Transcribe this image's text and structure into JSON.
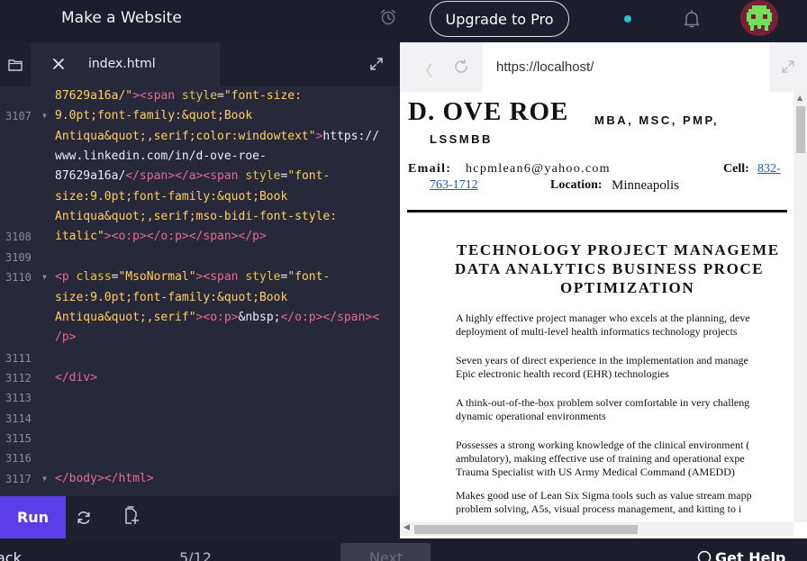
{
  "header": {
    "app_title": "Make a Website",
    "upgrade_label": "Upgrade to Pro"
  },
  "editor": {
    "tab_filename": "index.html",
    "lines": [
      {
        "num": "",
        "fold": false,
        "html": "<span class='s'>87629a16a/\"</span><span class='t'>&gt;&lt;span </span><span class='a'>style</span><span class='w'>=</span><span class='s'>\"font-size:</span>"
      },
      {
        "num": "3107",
        "fold": true,
        "html": "<span class='s'>9.0pt;font-family:&amp;quot;Book</span>"
      },
      {
        "num": "",
        "fold": false,
        "html": "<span class='s'>Antiqua&amp;quot;,serif;color:windowtext\"</span><span class='t'>&gt;</span><span class='w'>https://</span>"
      },
      {
        "num": "",
        "fold": false,
        "html": "<span class='w'>www.linkedin.com/in/d-ove-roe-</span>"
      },
      {
        "num": "",
        "fold": false,
        "html": "<span class='w'>87629a16a/</span><span class='t'>&lt;/span&gt;&lt;/a&gt;&lt;span </span><span class='a'>style</span><span class='w'>=</span><span class='s'>\"font-</span>"
      },
      {
        "num": "",
        "fold": false,
        "html": "<span class='s'>size:9.0pt;font-family:&amp;quot;Book</span>"
      },
      {
        "num": "",
        "fold": false,
        "html": "<span class='s'>Antiqua&amp;quot;,serif;mso-bidi-font-style:</span>"
      },
      {
        "num": "3108",
        "fold": false,
        "html": "<span class='s'>italic\"</span><span class='t'>&gt;&lt;o:p&gt;&lt;/o:p&gt;&lt;/span&gt;&lt;/p&gt;</span>"
      },
      {
        "num": "3109",
        "fold": false,
        "html": ""
      },
      {
        "num": "3110",
        "fold": true,
        "html": "<span class='t'>&lt;p </span><span class='a'>class</span><span class='w'>=</span><span class='s'>\"MsoNormal\"</span><span class='t'>&gt;&lt;span </span><span class='a'>style</span><span class='w'>=</span><span class='s'>\"font-</span>"
      },
      {
        "num": "",
        "fold": false,
        "html": "<span class='s'>size:9.0pt;font-family:&amp;quot;Book</span>"
      },
      {
        "num": "",
        "fold": false,
        "html": "<span class='s'>Antiqua&amp;quot;,serif\"</span><span class='t'>&gt;&lt;o:p&gt;</span><span class='w'>&amp;nbsp;</span><span class='t'>&lt;/o:p&gt;&lt;/span&gt;&lt;</span>"
      },
      {
        "num": "",
        "fold": false,
        "html": "<span class='t'>/p&gt;</span>"
      },
      {
        "num": "3111",
        "fold": false,
        "html": ""
      },
      {
        "num": "3112",
        "fold": false,
        "html": "<span class='t'>&lt;/div&gt;</span>"
      },
      {
        "num": "3113",
        "fold": false,
        "html": ""
      },
      {
        "num": "3114",
        "fold": false,
        "html": ""
      },
      {
        "num": "3115",
        "fold": false,
        "html": ""
      },
      {
        "num": "3116",
        "fold": false,
        "html": ""
      },
      {
        "num": "3117",
        "fold": true,
        "html": "<span class='t'>&lt;/body&gt;&lt;/html&gt;</span>"
      }
    ]
  },
  "runbar": {
    "run_label": "Run"
  },
  "browser": {
    "url": "https://localhost/",
    "document": {
      "name": "D. OVE ROE",
      "credentials_line1": "MBA, MSC, PMP,",
      "credentials_line2": "LSSMBB",
      "email_label": "Email:",
      "email": "hcpmlean6@yahoo.com",
      "cell_label": "Cell:",
      "cell_part1": "832-",
      "cell_part2": "763-1712",
      "location_label": "Location:",
      "location": "Minneapolis",
      "heading_line1": "TECHNOLOGY PROJECT MANAGEME",
      "heading_line2": "DATA ANALYTICS  BUSINESS PROCE",
      "heading_line3": "OPTIMIZATION",
      "bullets": [
        [
          "A highly effective project manager who excels at the planning, deve",
          " deployment of multi-level health informatics technology projects"
        ],
        [
          "Seven years of direct experience in the implementation and manage",
          " Epic electronic health record (EHR) technologies"
        ],
        [
          "A think-out-of-the-box problem solver comfortable in very challeng",
          " dynamic operational environments"
        ],
        [
          "Possesses a strong working knowledge of the clinical environment (",
          " ambulatory), making effective use of training and operational expe",
          " Trauma Specialist with US Army Medical Command (AMEDD)"
        ],
        [
          "Makes good use of Lean Six Sigma tools such as value stream mapp",
          " problem solving, A5s, visual process management, and kitting to i"
        ]
      ]
    }
  },
  "footer": {
    "back_label": "ack",
    "progress": "5/12",
    "next_label": "Next",
    "help_label": "Get Help"
  }
}
